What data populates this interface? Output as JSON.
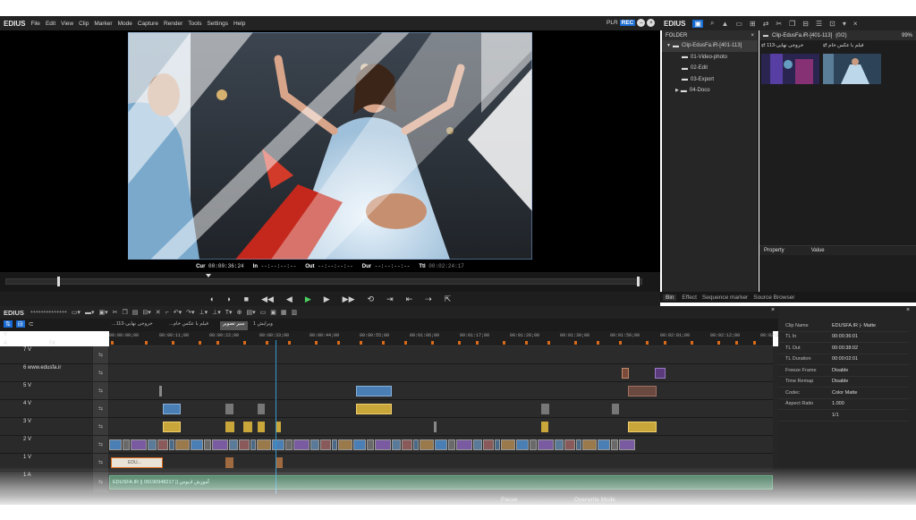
{
  "app": {
    "name": "EDIUS"
  },
  "menu": [
    "File",
    "Edit",
    "View",
    "Clip",
    "Marker",
    "Mode",
    "Capture",
    "Render",
    "Tools",
    "Settings",
    "Help"
  ],
  "player": {
    "plr": "PLR",
    "rec": "REC"
  },
  "timecodes": {
    "cur_label": "Cur",
    "cur": "00:00:36:24",
    "in_label": "In",
    "in": "--:--:--:--",
    "out_label": "Out",
    "out": "--:--:--:--",
    "dur_label": "Dur",
    "dur": "--:--:--:--",
    "ttl_label": "Ttl",
    "ttl": "00:02:24:17"
  },
  "bin": {
    "logo": "EDIUS",
    "folder_title": "FOLDER",
    "path": "Clip-EdusFa.iR-[401-113]",
    "count": "(0/2)",
    "zoom": "99%",
    "tree": [
      {
        "label": "Clip-EdusFa.iR-[401-113]",
        "level": 0,
        "expander": "▼"
      },
      {
        "label": "01-Video-photo",
        "level": 1,
        "expander": ""
      },
      {
        "label": "02-Edit",
        "level": 1,
        "expander": ""
      },
      {
        "label": "03-Export",
        "level": 1,
        "expander": ""
      },
      {
        "label": "04-Doco",
        "level": 1,
        "expander": "▶"
      }
    ],
    "clips": [
      {
        "caption": "خروجی نهایی-113"
      },
      {
        "caption": "فیلم با عکس خام"
      }
    ],
    "property_header": "Property",
    "value_header": "Value",
    "tabs": [
      "Bin",
      "Effect",
      "Sequence marker",
      "Source Browser"
    ]
  },
  "timeline": {
    "logo": "EDIUS",
    "project": "++++++++++++++",
    "seq_tabs": [
      "ویرایش 1",
      "سیر تصویر",
      "...فیلم با عکس خام",
      "...خروجی نهایی-113"
    ],
    "ruler": [
      "00:00:00;00",
      "00:00:11;00",
      "00:00:22;00",
      "00:00:33;00",
      "00:00:44;00",
      "00:00:55;00",
      "00:01:06;00",
      "00:01:17;00",
      "00:01:28;00",
      "00:01:39;00",
      "00:01:50;00",
      "00:02:01;00",
      "00:02:12;00",
      "00:02:2"
    ],
    "tracks": [
      {
        "name": "7 V"
      },
      {
        "name": "6 www.edusfa.ir"
      },
      {
        "name": "5 V"
      },
      {
        "name": "4 V"
      },
      {
        "name": "3 V"
      },
      {
        "name": "2 V"
      },
      {
        "name": "1 V"
      },
      {
        "name": "1 A"
      }
    ],
    "fit_label": "Fit",
    "clip_label_1": "EDU...",
    "audio_label": "EDUSFA.IR || 09190948217 || آموزش ادیوس",
    "channel_v": "V",
    "channel_a": "A"
  },
  "clip_info": [
    {
      "k": "Clip Name",
      "v": "EDUSFA.IR |- Matte"
    },
    {
      "k": "TL In",
      "v": "00:00:36:01"
    },
    {
      "k": "TL Out",
      "v": "00:00:38:02"
    },
    {
      "k": "TL Duration",
      "v": "00:00:02:01"
    },
    {
      "k": "Freeze Frame",
      "v": "Disable"
    },
    {
      "k": "Time Remap",
      "v": "Disable"
    },
    {
      "k": "Codec",
      "v": "Color Matte"
    },
    {
      "k": "Aspect Ratio",
      "v": "1.000"
    },
    {
      "k": "",
      "v": "1/1"
    }
  ],
  "status": {
    "pause": "Pause",
    "mode": "Overwrite Mode"
  },
  "colors": {
    "accent": "#1a6bd1",
    "play": "#4cd060",
    "marker": "#d96a1a",
    "clip_blue": "#4a7fb5",
    "clip_yellow": "#c9a63a"
  }
}
